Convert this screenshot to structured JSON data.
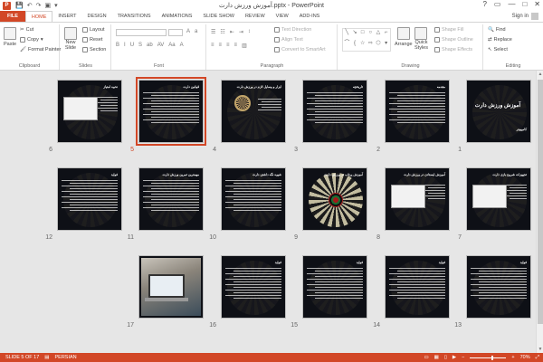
{
  "window": {
    "title": "آموزش ورزش دارت.pptx - PowerPoint",
    "app_icon": "P",
    "controls": [
      "?",
      "▭",
      "—",
      "□",
      "✕"
    ]
  },
  "tabs": [
    {
      "label": "FILE"
    },
    {
      "label": "HOME"
    },
    {
      "label": "INSERT"
    },
    {
      "label": "DESIGN"
    },
    {
      "label": "TRANSITIONS"
    },
    {
      "label": "ANIMATIONS"
    },
    {
      "label": "SLIDE SHOW"
    },
    {
      "label": "REVIEW"
    },
    {
      "label": "VIEW"
    },
    {
      "label": "ADD-INS"
    }
  ],
  "signin": "Sign in",
  "ribbon": {
    "clipboard": {
      "label": "Clipboard",
      "paste": "Paste",
      "cut": "Cut",
      "copy": "Copy",
      "format_painter": "Format Painter"
    },
    "slides": {
      "label": "Slides",
      "new_slide": "New",
      "new_slide_2": "Slide",
      "layout": "Layout",
      "reset": "Reset",
      "section": "Section"
    },
    "font": {
      "label": "Font"
    },
    "paragraph": {
      "label": "Paragraph",
      "text_direction": "Text Direction",
      "align_text": "Align Text",
      "convert": "Convert to SmartArt"
    },
    "drawing": {
      "label": "Drawing",
      "arrange": "Arrange",
      "quick_styles": "Quick",
      "quick_styles_2": "Styles",
      "shape_fill": "Shape Fill",
      "shape_outline": "Shape Outline",
      "shape_effects": "Shape Effects"
    },
    "editing": {
      "label": "Editing",
      "find": "Find",
      "replace": "Replace",
      "select": "Select"
    }
  },
  "slides": [
    {
      "num": "1",
      "title": "آموزش ورزش دارت",
      "sub": "کامپیوتر",
      "kind": "cover"
    },
    {
      "num": "2",
      "title": "مقدمه",
      "kind": "text"
    },
    {
      "num": "3",
      "title": "تاریخچه",
      "kind": "text"
    },
    {
      "num": "4",
      "title": "ابزار و وسایل لازم در ورزش دارت",
      "kind": "board-image"
    },
    {
      "num": "5",
      "title": "قوانین دارت",
      "kind": "text",
      "selected": true
    },
    {
      "num": "6",
      "title": "نحوه امتیاز",
      "kind": "white-image"
    },
    {
      "num": "7",
      "title": "تجهیزات شروع بازی دارت",
      "kind": "white-image"
    },
    {
      "num": "8",
      "title": "آموزش ایستادن در ورزش دارت",
      "kind": "white-image"
    },
    {
      "num": "9",
      "title": "آموزش پرتاب در ورزش دارت",
      "kind": "dartboard"
    },
    {
      "num": "10",
      "title": "شیوه نگه داشتن دارت",
      "kind": "text"
    },
    {
      "num": "11",
      "title": "مهمترین تمرین ورزش دارت",
      "kind": "text"
    },
    {
      "num": "12",
      "title": "فواید",
      "kind": "text"
    },
    {
      "num": "13",
      "title": "فواید",
      "kind": "text"
    },
    {
      "num": "14",
      "title": "فواید",
      "kind": "text"
    },
    {
      "num": "15",
      "title": "فواید",
      "kind": "text"
    },
    {
      "num": "16",
      "title": "فواید",
      "kind": "text"
    },
    {
      "num": "17",
      "title": "",
      "kind": "photo"
    }
  ],
  "status": {
    "slide_info": "SLIDE 5 OF 17",
    "language": "PERSIAN",
    "zoom": "70%"
  },
  "colors": {
    "accent": "#d24726",
    "slide_bg": "#0e1016"
  }
}
